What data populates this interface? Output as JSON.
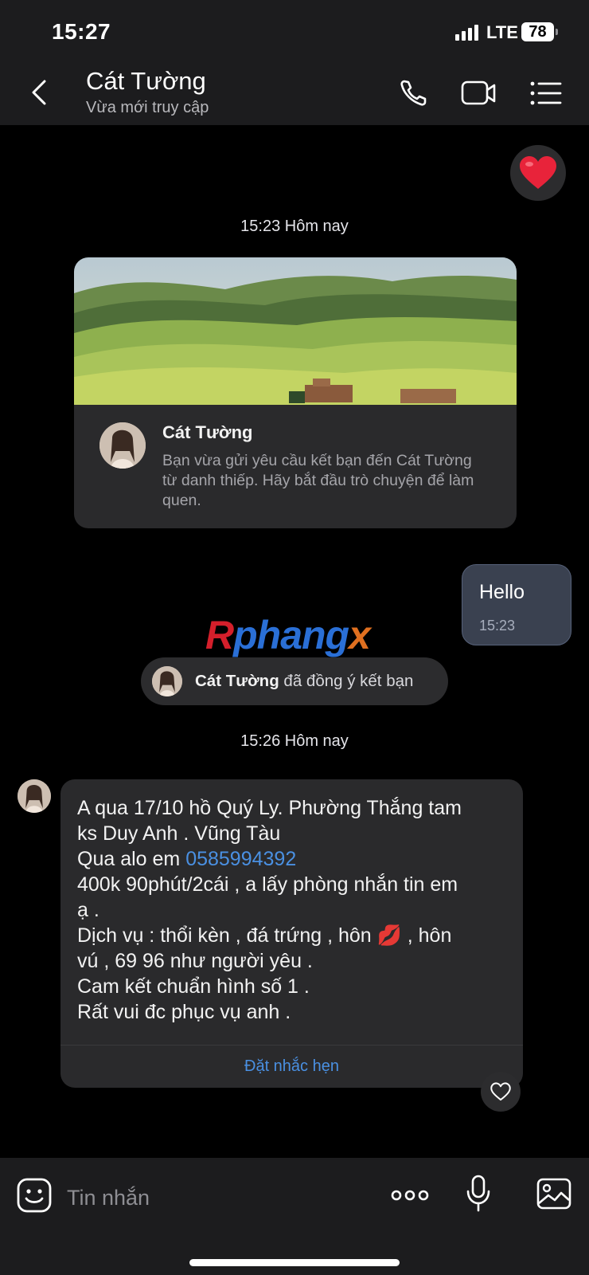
{
  "status_bar": {
    "time": "15:27",
    "network": "LTE",
    "battery": "78"
  },
  "header": {
    "name": "Cát Tường",
    "status": "Vừa mới truy cập"
  },
  "timestamps": {
    "first": "15:23 Hôm nay",
    "second": "15:26 Hôm nay"
  },
  "friend_card": {
    "name": "Cát Tường",
    "text": "Bạn vừa gửi yêu cầu kết bạn đến Cát Tường từ danh thiếp. Hãy bắt đầu trò chuyện để làm quen."
  },
  "sent_message": {
    "text": "Hello",
    "time": "15:23"
  },
  "watermark": {
    "text": "Rphangx"
  },
  "system_message": {
    "name": "Cát Tường",
    "text": " đã đồng ý kết bạn"
  },
  "received_message": {
    "lines": [
      "A qua 17/10 hồ Quý Ly. Phường Thắng tam",
      "ks Duy Anh . Vũng Tàu",
      "Qua alo em ",
      "400k 90phút/2cái , a lấy phòng nhắn tin em",
      "ạ .",
      "Dịch vụ : thổi kèn , đá trứng , hôn ",
      " , hôn",
      "vú , 69 96 như người yêu .",
      "Cam kết chuẩn hình số 1 .",
      "Rất vui đc phục vụ anh ."
    ],
    "phone": "0585994392",
    "emoji": "💋",
    "reminder_label": "Đặt nhắc hẹn"
  },
  "composer": {
    "placeholder": "Tin nhắn"
  },
  "icons": {
    "back": "chevron-left-icon",
    "call": "phone-icon",
    "video": "video-camera-icon",
    "menu": "list-menu-icon",
    "reaction": "heart-icon",
    "like": "heart-outline-icon",
    "sticker": "sticker-smile-icon",
    "more": "more-dots-icon",
    "mic": "microphone-icon",
    "gallery": "image-gallery-icon"
  },
  "colors": {
    "accent_link": "#4a90e2",
    "sent_bubble": "#3a4150",
    "heart": "#e8233a"
  }
}
